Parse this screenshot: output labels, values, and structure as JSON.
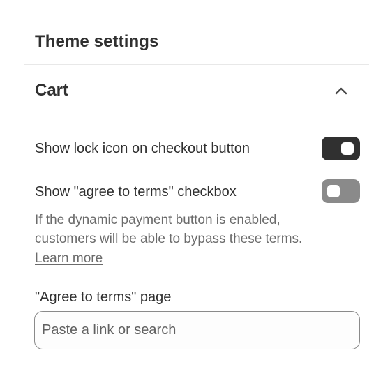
{
  "header": {
    "title": "Theme settings"
  },
  "section": {
    "title": "Cart",
    "expanded": true,
    "collapse_icon": "chevron-up-icon"
  },
  "settings": {
    "lock_icon": {
      "label": "Show lock icon on checkout button",
      "enabled": true
    },
    "agree_terms": {
      "label": "Show \"agree to terms\" checkbox",
      "enabled": false,
      "help_text": "If the dynamic payment button is enabled, customers will be able to bypass these terms.",
      "learn_more": "Learn more"
    },
    "terms_page": {
      "label": "\"Agree to terms\" page",
      "value": "",
      "placeholder": "Paste a link or search"
    }
  },
  "colors": {
    "toggle_on": "#303030",
    "toggle_off": "#8a8a8a",
    "text_primary": "#303030",
    "text_secondary": "#6b6b6b"
  }
}
